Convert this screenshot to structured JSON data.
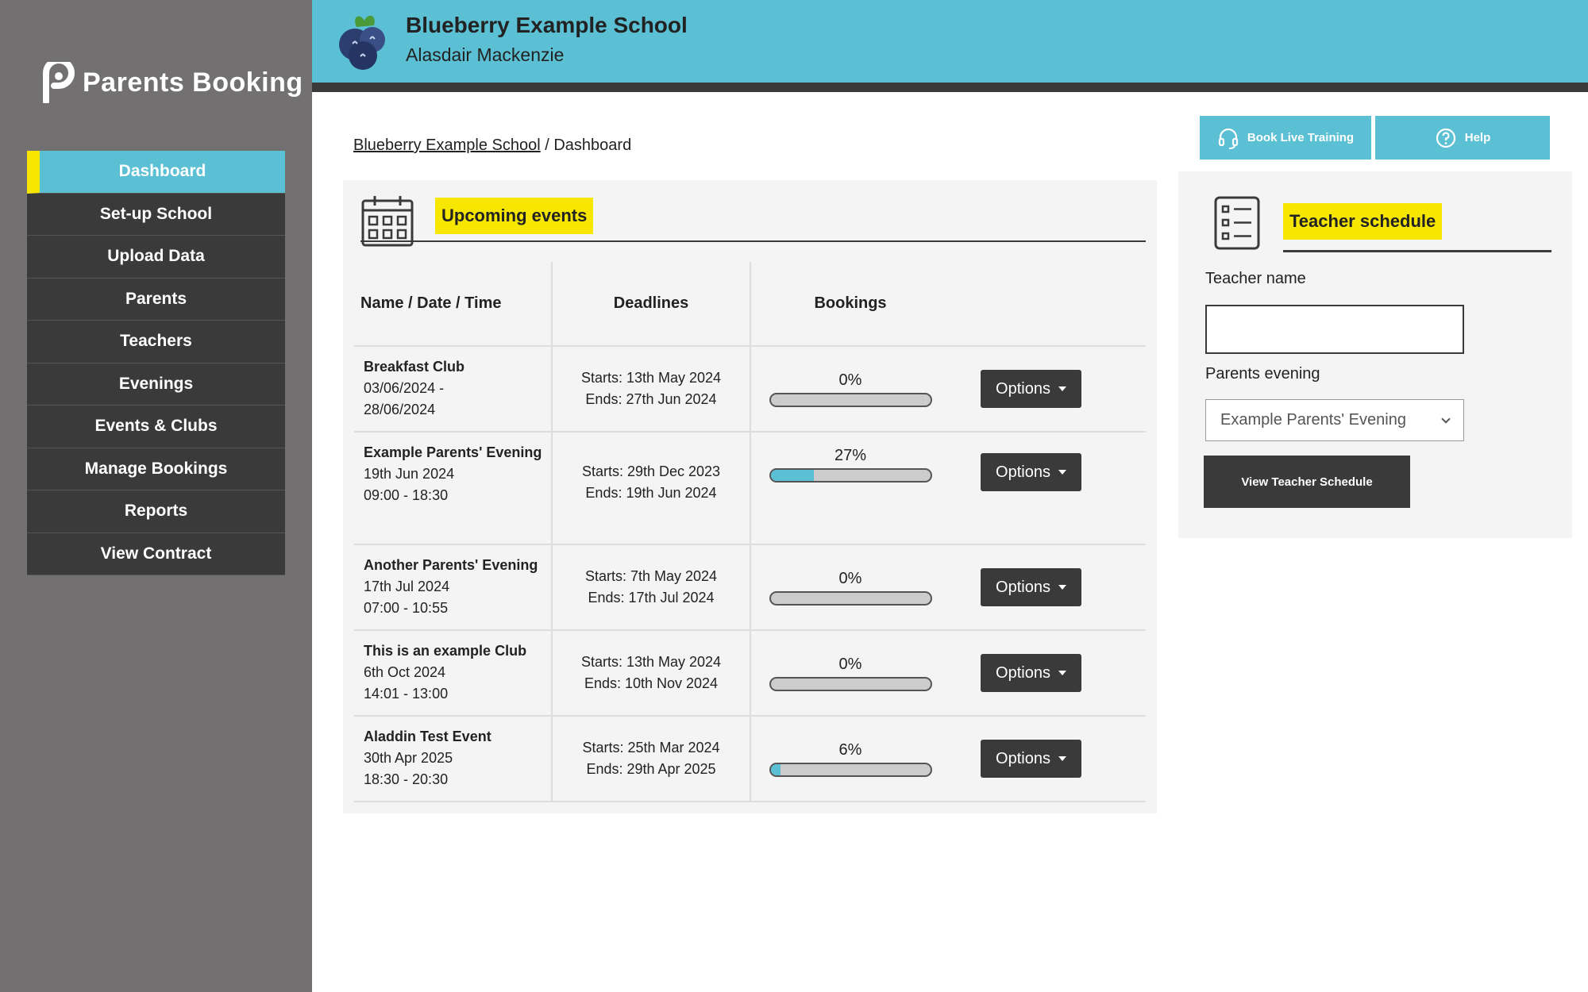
{
  "sidebar": {
    "logo_text": "Parents Booking",
    "items": [
      {
        "label": "Dashboard"
      },
      {
        "label": "Set-up School"
      },
      {
        "label": "Upload Data"
      },
      {
        "label": "Parents"
      },
      {
        "label": "Teachers"
      },
      {
        "label": "Evenings"
      },
      {
        "label": "Events & Clubs"
      },
      {
        "label": "Manage Bookings"
      },
      {
        "label": "Reports"
      },
      {
        "label": "View Contract"
      }
    ],
    "active_index": 0
  },
  "header": {
    "school_name": "Blueberry Example School",
    "user_name": "Alasdair Mackenzie"
  },
  "breadcrumb": {
    "link": "Blueberry Example School",
    "separator": " / ",
    "current": "Dashboard"
  },
  "top_buttons": {
    "training_label": "Book Live Training",
    "help_label": "Help"
  },
  "events": {
    "title": "Upcoming events",
    "headers": {
      "name": "Name / Date / Time",
      "deadlines": "Deadlines",
      "bookings": "Bookings"
    },
    "options_label": "Options",
    "rows": [
      {
        "name": "Breakfast Club",
        "line2": "03/06/2024 -",
        "line3": "28/06/2024",
        "starts": "Starts: 13th May 2024",
        "ends": "Ends: 27th Jun 2024",
        "pct_label": "0%",
        "pct": 0
      },
      {
        "name": "Example Parents' Evening",
        "line2": "19th Jun 2024",
        "line3": "09:00 - 18:30",
        "starts": "Starts: 29th Dec 2023",
        "ends": "Ends: 19th Jun 2024",
        "pct_label": "27%",
        "pct": 27
      },
      {
        "name": "Another Parents' Evening",
        "line2": "17th Jul 2024",
        "line3": "07:00 - 10:55",
        "starts": "Starts: 7th May 2024",
        "ends": "Ends: 17th Jul 2024",
        "pct_label": "0%",
        "pct": 0
      },
      {
        "name": "This is an example Club",
        "line2": "6th Oct 2024",
        "line3": "14:01 - 13:00",
        "starts": "Starts: 13th May 2024",
        "ends": "Ends: 10th Nov 2024",
        "pct_label": "0%",
        "pct": 0
      },
      {
        "name": "Aladdin Test Event",
        "line2": "30th Apr 2025",
        "line3": "18:30 - 20:30",
        "starts": "Starts: 25th Mar 2024",
        "ends": "Ends: 29th Apr 2025",
        "pct_label": "6%",
        "pct": 6
      }
    ]
  },
  "teacher_schedule": {
    "title": "Teacher schedule",
    "teacher_label": "Teacher name",
    "teacher_value": "",
    "evening_label": "Parents evening",
    "evening_selected": "Example Parents' Evening",
    "button_label": "View Teacher Schedule"
  },
  "colors": {
    "accent": "#5bc0d4",
    "highlight": "#f6e600",
    "dark": "#3a3a3a",
    "sidebar": "#727071"
  }
}
